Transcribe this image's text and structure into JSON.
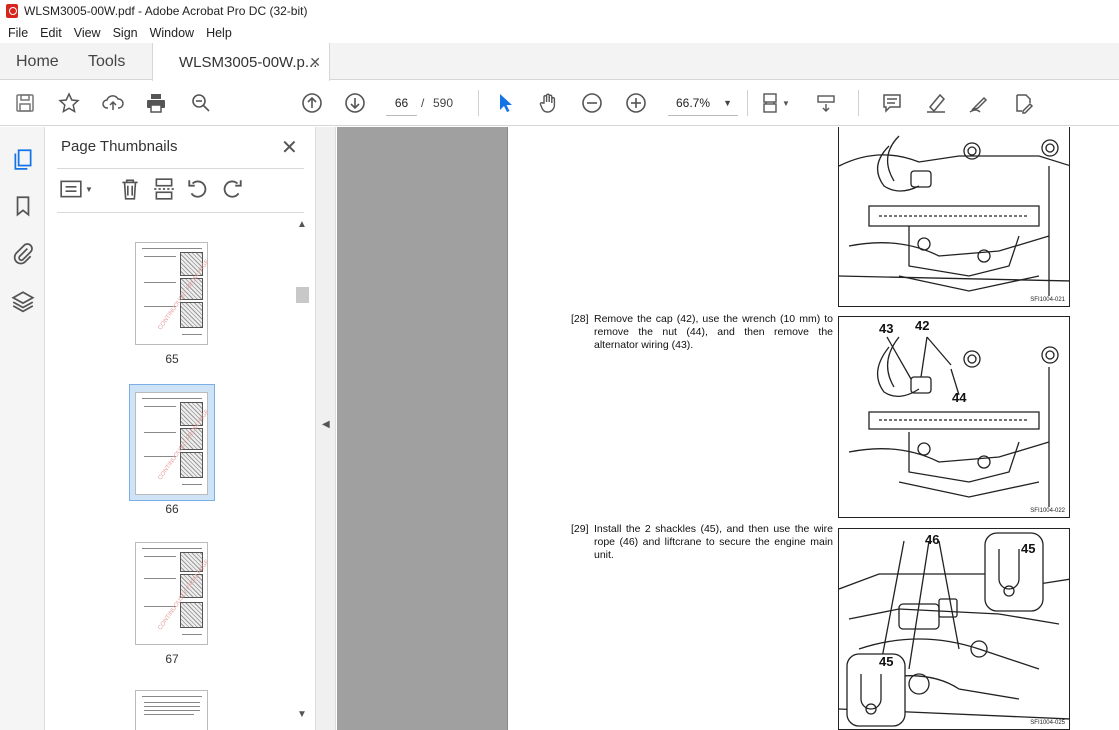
{
  "window": {
    "title": "WLSM3005-00W.pdf - Adobe Acrobat Pro DC (32-bit)"
  },
  "menu": [
    "File",
    "Edit",
    "View",
    "Sign",
    "Window",
    "Help"
  ],
  "tabs": {
    "home": "Home",
    "tools": "Tools",
    "doc": "WLSM3005-00W.p...",
    "close": "✕"
  },
  "toolbar": {
    "page_current": "66",
    "page_sep": "/",
    "page_total": "590",
    "zoom": "66.7%"
  },
  "panel": {
    "title": "Page Thumbnails",
    "close": "✕"
  },
  "thumbnails": [
    {
      "label": "65"
    },
    {
      "label": "66",
      "selected": true
    },
    {
      "label": "67"
    }
  ],
  "thumb_watermark": "CONTINUOUSLY FROM PAGE",
  "document": {
    "steps": [
      {
        "num": "[28]",
        "text": "Remove the cap (42), use the wrench (10 mm) to remove the nut (44), and then remove the alternator wiring (43)."
      },
      {
        "num": "[29]",
        "text": "Install the 2 shackles (45), and then use the wire rope (46) and liftcrane to secure the engine main unit."
      }
    ],
    "figures": [
      {
        "code": "SFI1004-021",
        "callouts": []
      },
      {
        "code": "SFI1004-022",
        "callouts": [
          "43",
          "42",
          "44"
        ]
      },
      {
        "code": "SFI1004-025",
        "callouts": [
          "46",
          "45",
          "45"
        ]
      }
    ]
  }
}
